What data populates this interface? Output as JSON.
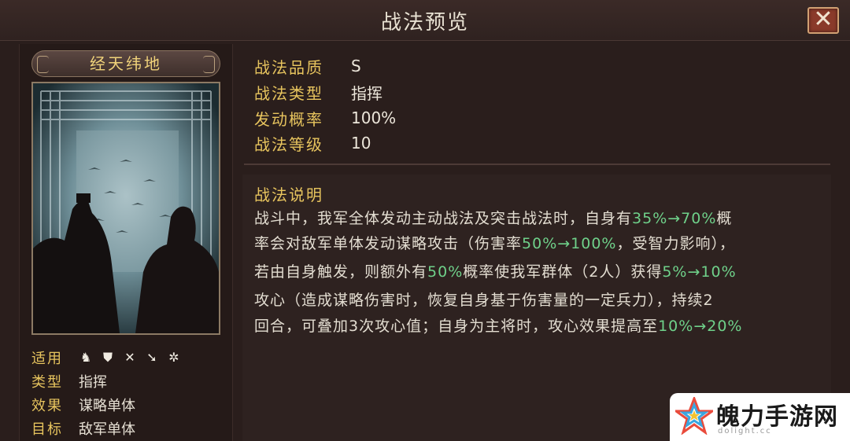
{
  "window": {
    "title": "战法预览",
    "close_label": "✕"
  },
  "skill": {
    "name": "经天纬地"
  },
  "left_props": {
    "applicable_label": "适用",
    "applicable_icons": [
      "cavalry-icon",
      "shield-icon",
      "bow-icon",
      "spear-icon",
      "siege-icon"
    ],
    "type_label": "类型",
    "type_value": "指挥",
    "effect_label": "效果",
    "effect_value": "谋略单体",
    "target_label": "目标",
    "target_value": "敌军单体"
  },
  "stats": [
    {
      "label": "战法品质",
      "value": "S"
    },
    {
      "label": "战法类型",
      "value": "指挥"
    },
    {
      "label": "发动概率",
      "value": "100%"
    },
    {
      "label": "战法等级",
      "value": "10"
    }
  ],
  "description": {
    "title": "战法说明",
    "l1a": "战斗中，我军全体发动主动战法及突击战法时，自身有",
    "l1h": "35%→70%",
    "l1b": "概",
    "l2a": "率会对敌军单体发动谋略攻击（伤害率",
    "l2h": "50%→100%",
    "l2b": "，受智力影响），",
    "l3a": "若由自身触发，则额外有",
    "l3h1": "50%",
    "l3b": "概率使我军群体（2人）获得",
    "l3h2": "5%→10%",
    "l4": "攻心（造成谋略伤害时，恢复自身基于伤害量的一定兵力），持续2",
    "l5a": "回合，可叠加3次攻心值；自身为主将时，攻心效果提高至",
    "l5h": "10%→20%"
  },
  "watermark": {
    "name": "魄力手游网",
    "sub": "dolight.cc"
  },
  "colors": {
    "accent_gold": "#e7c45e",
    "highlight_green": "#6fd18a",
    "background": "#2a1e1c"
  }
}
